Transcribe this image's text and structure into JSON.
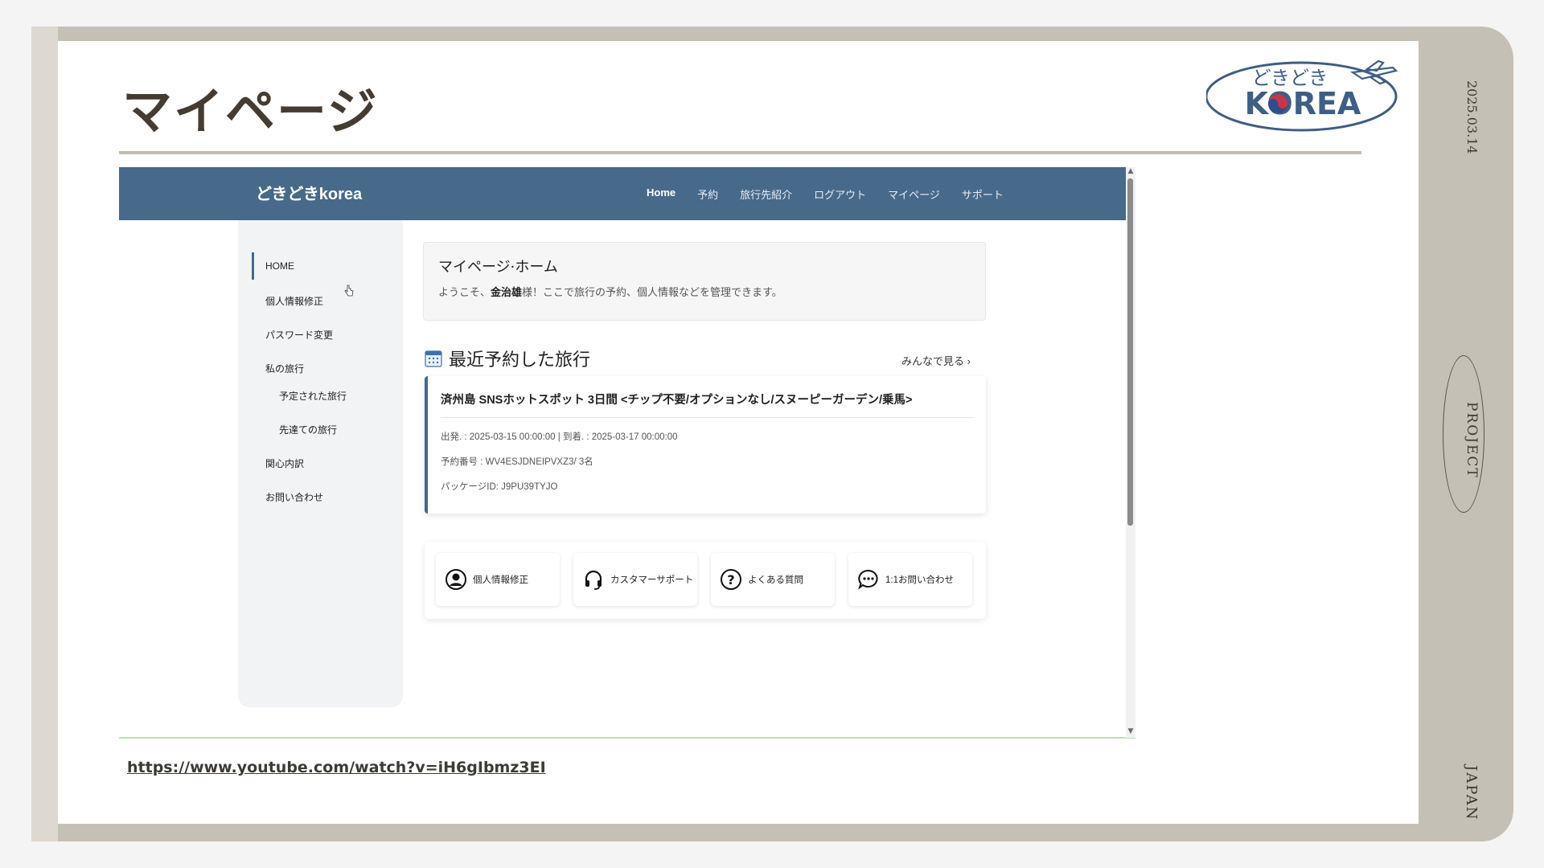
{
  "slide": {
    "title": "マイページ",
    "date": "2025.03.14",
    "side_project": "PROJECT",
    "side_japan": "JAPAN",
    "logo": {
      "line1": "どきどき",
      "line2": "KOREA"
    },
    "link": "https://www.youtube.com/watch?v=iH6gIbmz3EI"
  },
  "site": {
    "brand": "どきどきkorea",
    "nav": [
      "Home",
      "予約",
      "旅行先紹介",
      "ログアウト",
      "マイページ",
      "サポート"
    ],
    "sidebar": [
      "HOME",
      "個人情報修正",
      "パスワード変更",
      "私の旅行",
      "予定された旅行",
      "先達ての旅行",
      "関心内訳",
      "お問い合わせ"
    ],
    "welcome": {
      "title": "マイページ·ホーム",
      "prefix": "ようこそ、",
      "name": "金治雄",
      "suffix": "様！ここで旅行の予約、個人情報などを管理できます。"
    },
    "recent": {
      "title": "最近予約した旅行",
      "more": "みんなで見る ›"
    },
    "trip": {
      "title": "済州島 SNSホットスポット 3日間 <チップ不要/オプションなし/スヌーピーガーデン/乗馬>",
      "dates": "出発. : 2025-03-15 00:00:00 | 到着. : 2025-03-17 00:00:00",
      "reservation": "予約番号 : WV4ESJDNEIPVXZ3/ 3名",
      "package": "パッケージID: J9PU39TYJO"
    },
    "quick": [
      "個人情報修正",
      "カスタマーサポート",
      "よくある質問",
      "1:1お問い合わせ"
    ]
  },
  "colors": {
    "nav_bg": "#47698a",
    "frame": "#c5c0b6",
    "title": "#443b33"
  }
}
